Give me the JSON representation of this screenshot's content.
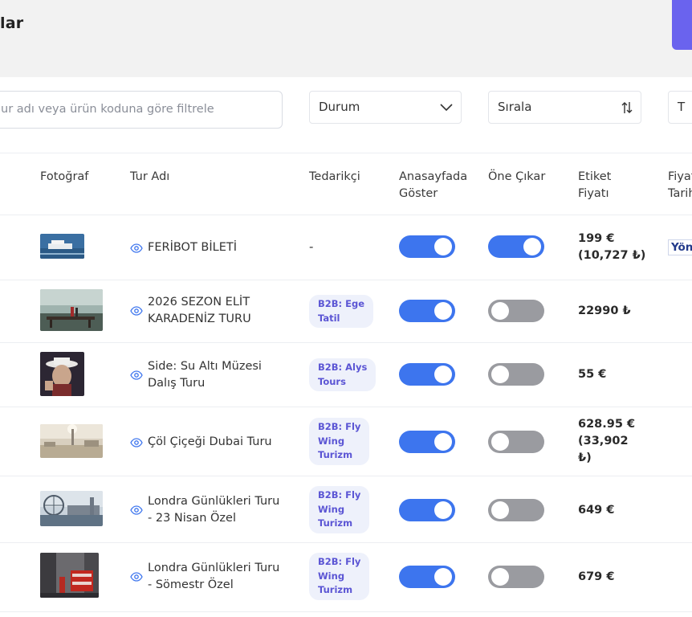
{
  "header": {
    "title": "lar"
  },
  "filters": {
    "search_placeholder": "ur adı veya ürün koduna göre filtrele",
    "status_label": "Durum",
    "sort_label": "Sırala",
    "extra_label": "T"
  },
  "table": {
    "headers": {
      "photo": "Fotoğraf",
      "name": "Tur Adı",
      "supplier": "Tedarikçi",
      "homepage_line1": "Anasayfada",
      "homepage_line2": "Göster",
      "featured": "Öne Çıkar",
      "label_price_line1": "Etiket",
      "label_price_line2": "Fiyatı",
      "price_date_line1": "Fiyat",
      "price_date_line2": "Tarih"
    },
    "rows": [
      {
        "name_line1": "FERİBOT BİLETİ",
        "name_line2": "",
        "supplier": "-",
        "supplier_line1": "",
        "supplier_line2": "",
        "supplier_line3": "",
        "show_homepage": true,
        "featured": true,
        "price_line1": "199 €",
        "price_line2": "(10,727 ₺)",
        "price_line3": "",
        "action": "Yön"
      },
      {
        "name_line1": "2026 SEZON ELİT",
        "name_line2": "KARADENİZ TURU",
        "supplier_line1": "B2B: Ege",
        "supplier_line2": "Tatil",
        "supplier_line3": "",
        "show_homepage": true,
        "featured": false,
        "price_line1": "22990 ₺",
        "price_line2": "",
        "price_line3": ""
      },
      {
        "name_line1": "Side: Su Altı Müzesi",
        "name_line2": "Dalış Turu",
        "supplier_line1": "B2B: Alys",
        "supplier_line2": "Tours",
        "supplier_line3": "",
        "show_homepage": true,
        "featured": false,
        "price_line1": "55 €",
        "price_line2": "",
        "price_line3": ""
      },
      {
        "name_line1": "Çöl Çiçeği Dubai Turu",
        "name_line2": "",
        "supplier_line1": "B2B: Fly",
        "supplier_line2": "Wing",
        "supplier_line3": "Turizm",
        "show_homepage": true,
        "featured": false,
        "price_line1": "628.95 €",
        "price_line2": "(33,902",
        "price_line3": "₺)"
      },
      {
        "name_line1": "Londra Günlükleri Turu",
        "name_line2": "- 23 Nisan Özel",
        "supplier_line1": "B2B: Fly",
        "supplier_line2": "Wing",
        "supplier_line3": "Turizm",
        "show_homepage": true,
        "featured": false,
        "price_line1": "649 €",
        "price_line2": "",
        "price_line3": ""
      },
      {
        "name_line1": "Londra Günlükleri Turu",
        "name_line2": "- Sömestr Özel",
        "supplier_line1": "B2B: Fly",
        "supplier_line2": "Wing",
        "supplier_line3": "Turizm",
        "show_homepage": true,
        "featured": false,
        "price_line1": "679 €",
        "price_line2": "",
        "price_line3": ""
      }
    ]
  },
  "colors": {
    "accent": "#6a63ee",
    "toggle_on": "#3d75ee",
    "toggle_off": "#9a9ba0",
    "badge_bg": "#eef1fb",
    "badge_text": "#5b55d4"
  },
  "icons": [
    "eye-icon",
    "chevron-down-icon",
    "sort-arrows-icon"
  ]
}
